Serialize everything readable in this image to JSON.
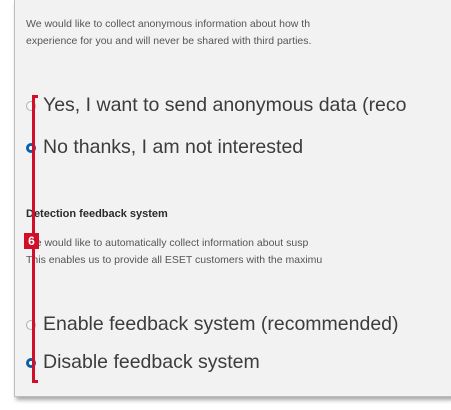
{
  "privacy": {
    "description_lines": [
      "We would like to collect anonymous information about how th",
      "experience for you and will never be shared with third parties."
    ],
    "options": [
      {
        "label": "Yes, I want to send anonymous data (reco",
        "selected": false
      },
      {
        "label": "No thanks, I am not interested",
        "selected": true
      }
    ]
  },
  "detection": {
    "heading": "Detection feedback system",
    "description_lines": [
      "We would like to automatically collect information about susp",
      "This enables us to provide all ESET customers with the maximu"
    ],
    "options": [
      {
        "label": "Enable feedback system (recommended)",
        "selected": false
      },
      {
        "label": "Disable feedback system",
        "selected": true
      }
    ]
  },
  "callout": {
    "badge_number": "6",
    "color": "#d0102a"
  },
  "colors": {
    "accent_radio": "#0c5fa5",
    "panel_bg": "#f2f2f2"
  }
}
